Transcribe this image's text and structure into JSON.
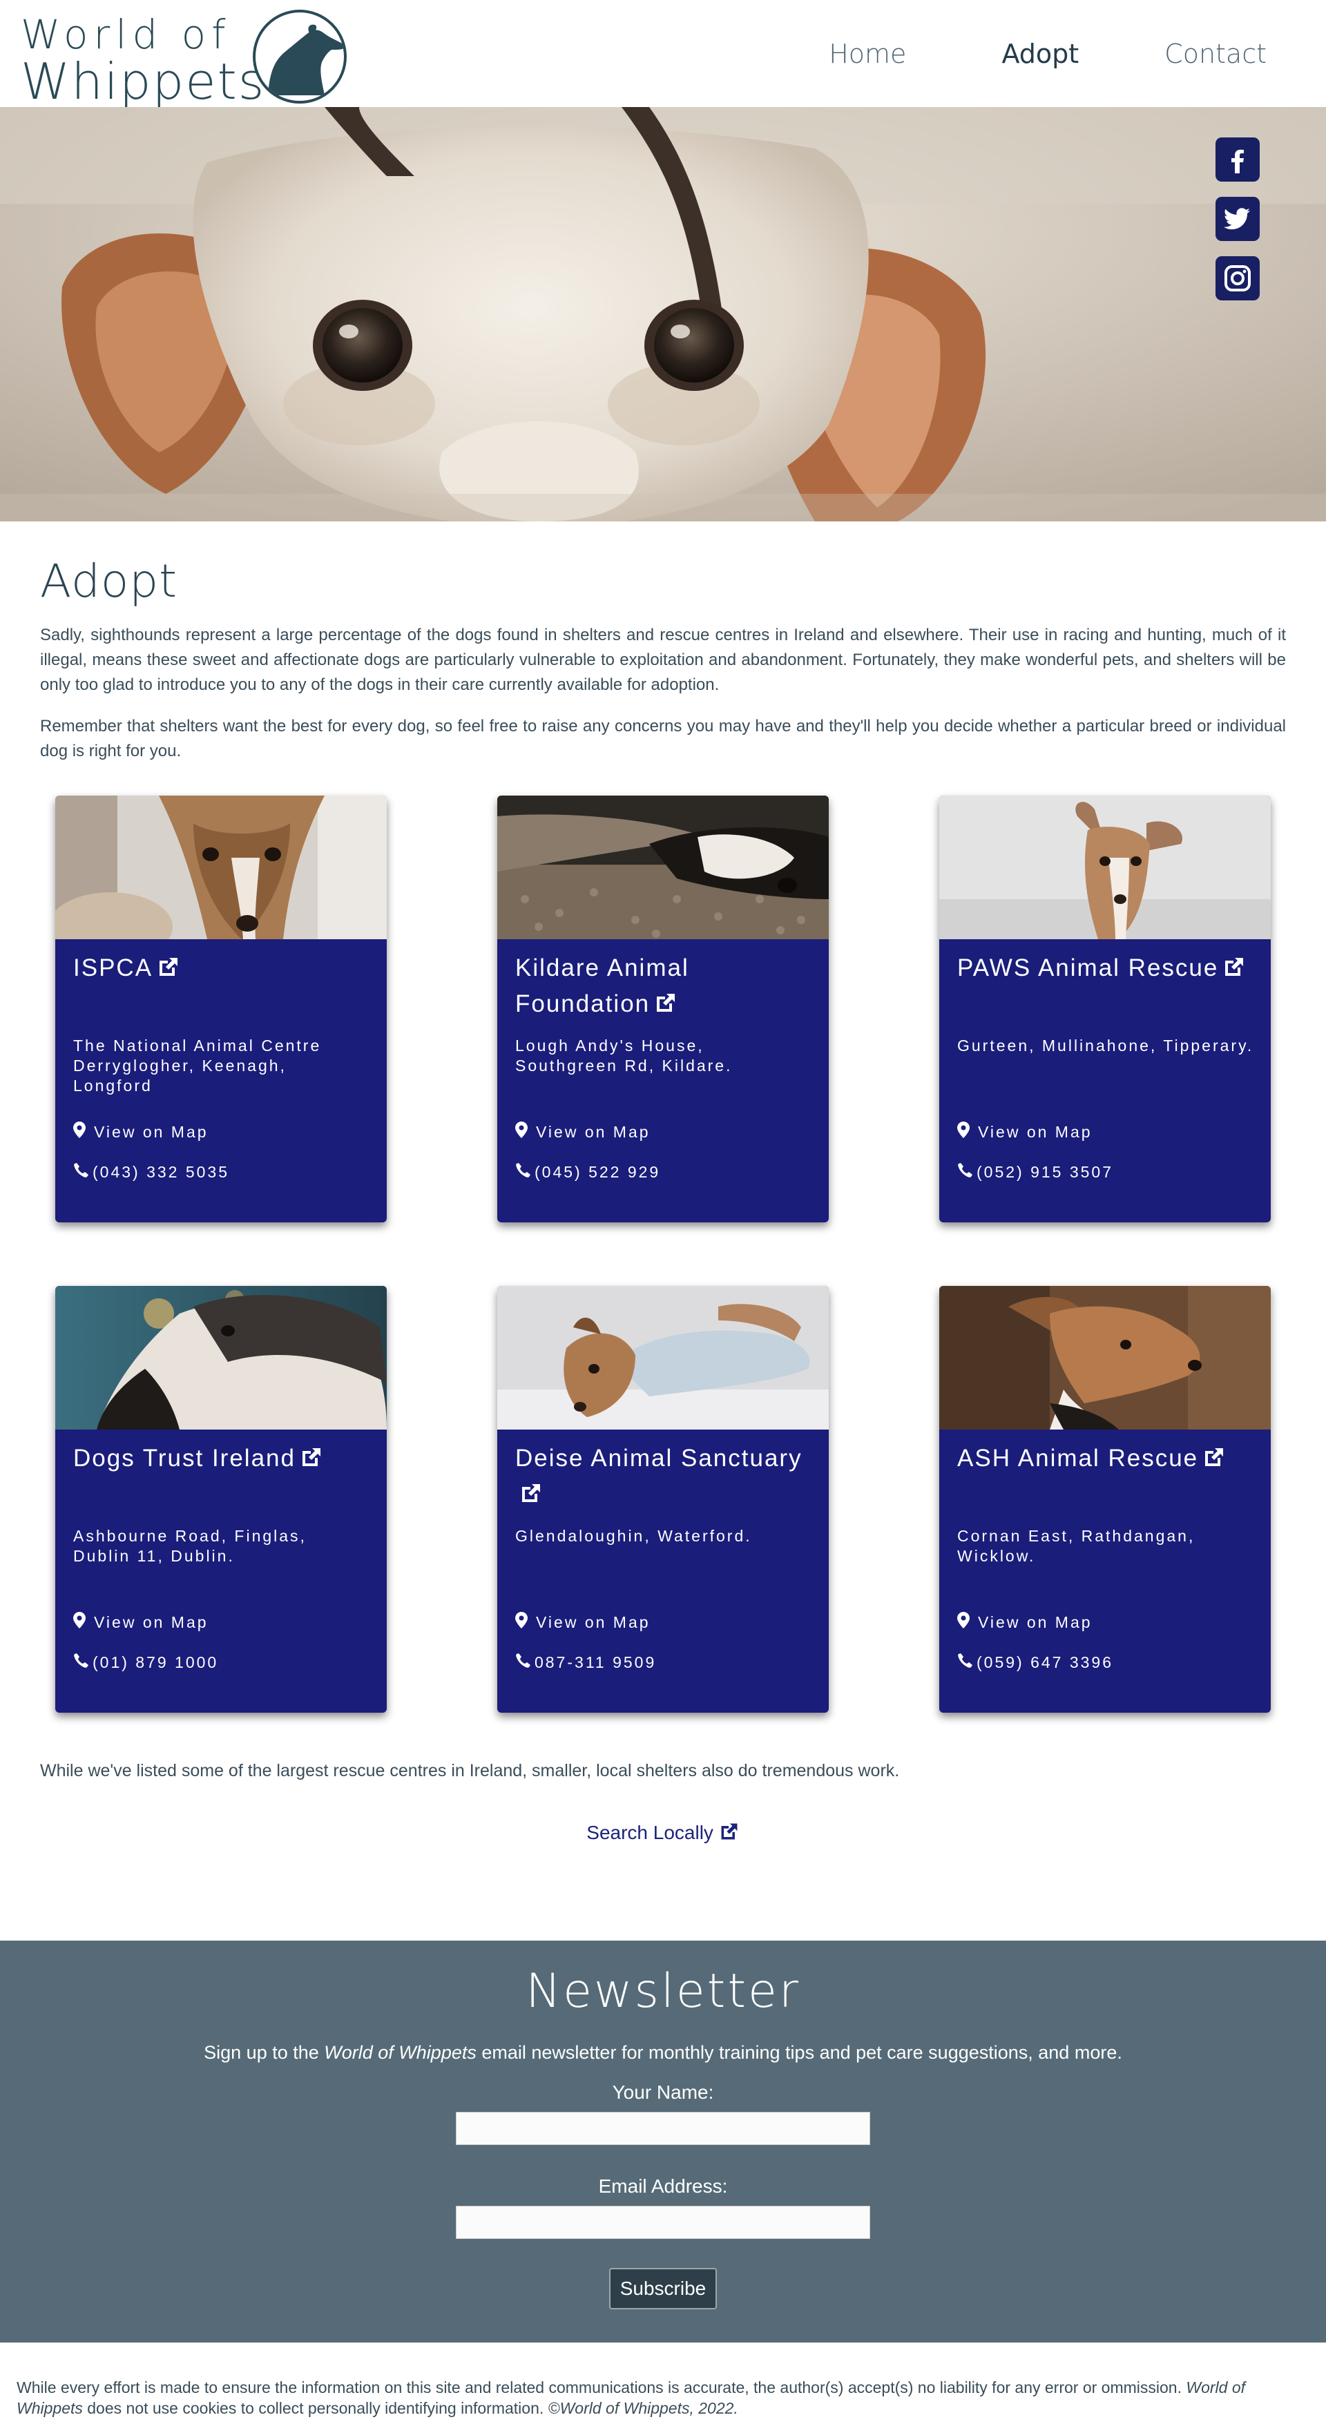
{
  "header": {
    "logo_line1": "World of",
    "logo_line2": "Whippets",
    "nav": [
      {
        "label": "Home"
      },
      {
        "label": "Adopt",
        "active": true
      },
      {
        "label": "Contact"
      }
    ]
  },
  "hero": {
    "social": [
      {
        "icon": "facebook-icon"
      },
      {
        "icon": "twitter-icon"
      },
      {
        "icon": "instagram-icon"
      }
    ]
  },
  "main": {
    "title": "Adopt",
    "paragraph1": "Sadly, sighthounds represent a large percentage of the dogs found in shelters and rescue centres in Ireland and elsewhere. Their use in racing and hunting, much of it illegal, means these sweet and affectionate dogs are particularly vulnerable to exploitation and abandonment. Fortunately, they make wonderful pets, and shelters will be only too glad to introduce you to any of the dogs in their care currently available for adoption.",
    "paragraph2": "Remember that shelters want the best for every dog, so feel free to raise any concerns you may have and they'll help you decide whether a particular breed or individual dog is right for you.",
    "map_label": "View on Map",
    "shelters": [
      {
        "name": "ISPCA",
        "address": "The National Animal Centre Derryglogher, Keenagh, Longford",
        "phone": "(043) 332 5035"
      },
      {
        "name": "Kildare Animal Foundation",
        "address": "Lough Andy's House, Southgreen Rd, Kildare.",
        "phone": "(045) 522 929"
      },
      {
        "name": "PAWS Animal Rescue",
        "address": "Gurteen, Mullinahone, Tipperary.",
        "phone": "(052) 915 3507"
      },
      {
        "name": "Dogs Trust Ireland",
        "address": "Ashbourne Road, Finglas, Dublin 11, Dublin.",
        "phone": "(01) 879 1000"
      },
      {
        "name": "Deise Animal Sanctuary",
        "address": "Glendaloughin, Waterford.",
        "phone": "087-311 9509"
      },
      {
        "name": "ASH Animal Rescue",
        "address": "Cornan East, Rathdangan, Wicklow.",
        "phone": "(059) 647 3396"
      }
    ],
    "note": "While we've listed some of the largest rescue centres in Ireland, smaller, local shelters also do tremendous work.",
    "search_locally": "Search Locally"
  },
  "newsletter": {
    "title": "Newsletter",
    "text_before": "Sign up to the ",
    "text_em": "World of Whippets",
    "text_after": " email newsletter for monthly training tips and pet care suggestions, and more.",
    "name_label": "Your Name:",
    "email_label": "Email Address:",
    "subscribe": "Subscribe"
  },
  "footer": {
    "text1": "While every effort is made to ensure the information on this site and related communications is accurate, the author(s) accept(s) no liability for any error or ommission. ",
    "em1": "World of Whippets",
    "text2": " does not use cookies to collect personally identifying information. ",
    "em2": "©World of Whippets, 2022."
  },
  "colors": {
    "card_bg": "#1a1d7a",
    "newsletter_bg": "#566b77",
    "heading": "#2b4452",
    "link": "#1b237a"
  }
}
